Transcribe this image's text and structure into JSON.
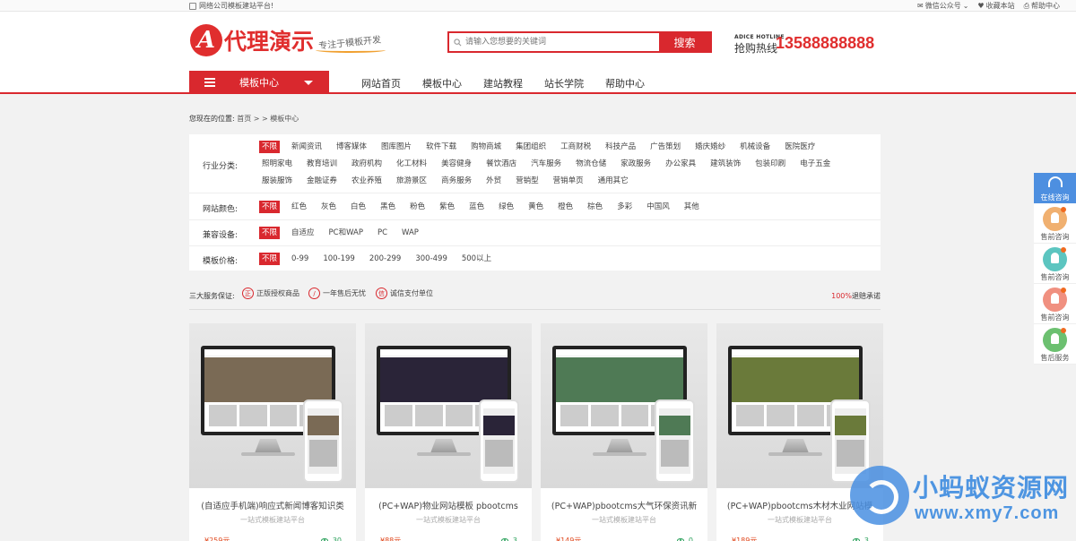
{
  "topbar": {
    "left_text": "网络公司模板建站平台!",
    "wechat": "微信公众号",
    "favorite": "收藏本站",
    "help": "帮助中心"
  },
  "header": {
    "logo_letter": "A",
    "logo_text": "代理演示",
    "slogan": "专注于模板开发",
    "search_placeholder": "请输入您想要的关键词",
    "search_button": "搜索",
    "hotline_en": "ADICE HOTLINE",
    "hotline_label": "抢购热线",
    "hotline_number": "13588888888"
  },
  "nav": {
    "category_label": "模板中心",
    "links": [
      "网站首页",
      "模板中心",
      "建站教程",
      "站长学院",
      "帮助中心"
    ]
  },
  "breadcrumb": {
    "label": "您现在的位置:",
    "path": "首页 > > 模板中心"
  },
  "filters": [
    {
      "label": "行业分类:",
      "options": [
        "不限",
        "新闻资讯",
        "博客媒体",
        "图库图片",
        "软件下载",
        "购物商城",
        "集团组织",
        "工商财税",
        "科技产品",
        "广告策划",
        "婚庆婚纱",
        "机械设备",
        "医院医疗",
        "照明家电",
        "教育培训",
        "政府机构",
        "化工材料",
        "美容健身",
        "餐饮酒店",
        "汽车服务",
        "物流仓储",
        "家政服务",
        "办公家具",
        "建筑装饰",
        "包装印刷",
        "电子五金",
        "服装服饰",
        "金融证券",
        "农业养殖",
        "旅游景区",
        "商务服务",
        "外贸",
        "营销型",
        "营销单页",
        "通用其它"
      ]
    },
    {
      "label": "网站颜色:",
      "options": [
        "不限",
        "红色",
        "灰色",
        "白色",
        "黑色",
        "粉色",
        "紫色",
        "蓝色",
        "绿色",
        "黄色",
        "橙色",
        "棕色",
        "多彩",
        "中国风",
        "其他"
      ]
    },
    {
      "label": "兼容设备:",
      "options": [
        "不限",
        "自适应",
        "PC和WAP",
        "PC",
        "WAP"
      ]
    },
    {
      "label": "模板价格:",
      "options": [
        "不限",
        "0-99",
        "100-199",
        "200-299",
        "300-499",
        "500以上"
      ]
    }
  ],
  "services": {
    "label": "三大服务保证:",
    "items": [
      {
        "icon": "正",
        "text": "正版授权商品"
      },
      {
        "icon": "/",
        "text": "一年售后无忧"
      },
      {
        "icon": "信",
        "text": "诚信支付单位"
      }
    ],
    "refund_pct": "100%",
    "refund_text": "退赔承诺"
  },
  "products": [
    {
      "title": "(自适应手机端)响应式新闻博客知识类",
      "subtitle": "一站式模板建站平台",
      "price": "¥259元",
      "views": "30",
      "hero_color": "#7a6a55",
      "theme": "#333"
    },
    {
      "title": "(PC+WAP)物业网站模板 pbootcms",
      "subtitle": "一站式模板建站平台",
      "price": "¥88元",
      "views": "3",
      "hero_color": "#2a2438",
      "theme": "#111"
    },
    {
      "title": "(PC+WAP)pbootcms大气环保资讯新",
      "subtitle": "一站式模板建站平台",
      "price": "¥149元",
      "views": "0",
      "hero_color": "#4f7a55",
      "theme": "#1d5a8a"
    },
    {
      "title": "(PC+WAP)pbootcms木材木业网站模",
      "subtitle": "一站式模板建站平台",
      "price": "¥189元",
      "views": "3",
      "hero_color": "#6a7a3a",
      "theme": "#2c7a2c"
    }
  ],
  "side_widget": {
    "top_label": "在线咨询",
    "items": [
      {
        "label": "售前咨询",
        "color": "#f0b070"
      },
      {
        "label": "售前咨询",
        "color": "#5cc5c0"
      },
      {
        "label": "售前咨询",
        "color": "#f09080"
      },
      {
        "label": "售后服务",
        "color": "#6cc070"
      }
    ]
  },
  "watermark": {
    "cn": "小蚂蚁资源网",
    "url": "www.xmy7.com"
  },
  "colors": {
    "brand_red": "#d9282e",
    "price_orange": "#e0491f",
    "views_green": "#2aa05a",
    "widget_blue": "#4d8fe0"
  }
}
